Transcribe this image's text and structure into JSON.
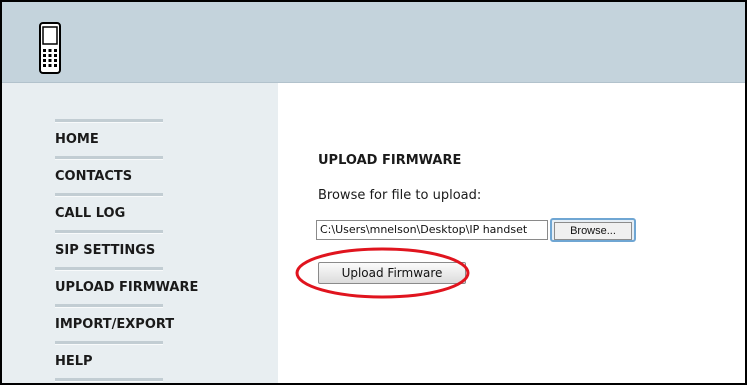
{
  "header": {
    "icon": "mobile-phone-icon",
    "background_color": "#c4d3dc"
  },
  "sidebar": {
    "items": [
      {
        "label": "HOME"
      },
      {
        "label": "CONTACTS"
      },
      {
        "label": "CALL LOG"
      },
      {
        "label": "SIP SETTINGS"
      },
      {
        "label": "UPLOAD FIRMWARE"
      },
      {
        "label": "IMPORT/EXPORT"
      },
      {
        "label": "HELP"
      }
    ]
  },
  "main": {
    "title": "UPLOAD FIRMWARE",
    "browse_label": "Browse for file to upload:",
    "file_value": "C:\\Users\\mnelson\\Desktop\\IP handset",
    "browse_button": "Browse...",
    "upload_button": "Upload Firmware"
  },
  "annotation": {
    "color": "#e0141e",
    "marks": "upload-firmware-button"
  }
}
